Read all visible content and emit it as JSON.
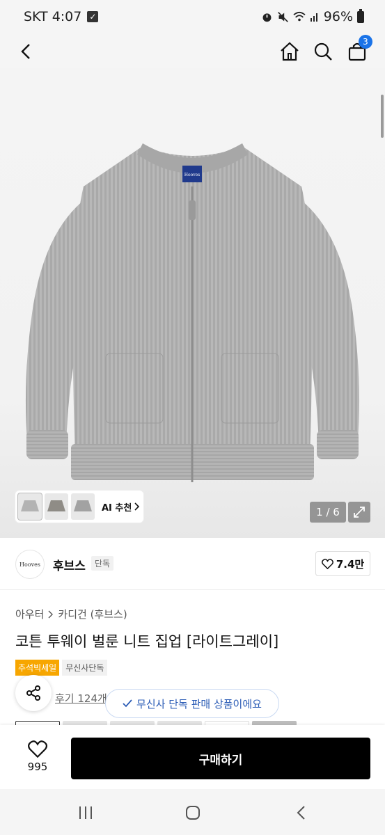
{
  "status_bar": {
    "carrier_time": "SKT 4:07",
    "battery": "96%",
    "icons": [
      "alarm-icon",
      "mute-icon",
      "wifi-icon",
      "signal-icon",
      "battery-icon"
    ]
  },
  "header": {
    "icons": [
      "back-icon",
      "home-icon",
      "search-icon",
      "cart-icon"
    ],
    "cart_count": "3"
  },
  "gallery": {
    "ai_recommend_label": "AI 추천",
    "page_indicator": "1 / 6",
    "thumbnails": [
      "thumb-1",
      "thumb-2",
      "thumb-3"
    ]
  },
  "brand": {
    "logo_text": "Hooves",
    "name": "후브스",
    "tag": "단독",
    "likes": "7.4만"
  },
  "product": {
    "breadcrumb": [
      "아우터",
      "카디건 (후브스)"
    ],
    "title": "코튼 투웨이 벌룬 니트 집업 [라이트그레이]",
    "badge_sale": "추석빅세일",
    "badge_exclusive": "무신사단독",
    "review_text": "후기 124개",
    "toast_text": "무신사 단독 판매 상품이에요"
  },
  "purchase_bar": {
    "wish_count": "995",
    "buy_label": "구매하기"
  },
  "colors": {
    "accent_blue": "#1a73e8",
    "sale_orange": "#f7a600",
    "buy_button": "#000000"
  }
}
